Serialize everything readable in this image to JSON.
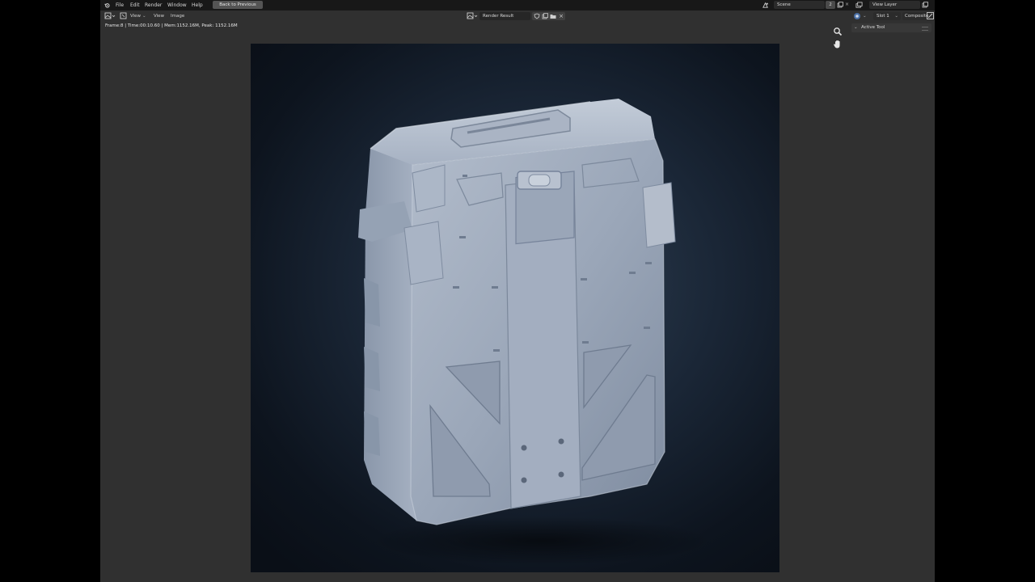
{
  "topbar": {
    "menus": [
      "File",
      "Edit",
      "Render",
      "Window",
      "Help"
    ],
    "back_button": "Back to Previous",
    "scene_name": "Scene",
    "scene_users": "2",
    "view_layer": "View Layer"
  },
  "image_editor": {
    "menus": [
      "View",
      "View",
      "Image"
    ],
    "image_name": "Render Result",
    "status": "Frame:8 | Time:00:10.60 | Mem:1152.16M, Peak: 1152.16M"
  },
  "sidebar": {
    "slot": "Slot 1",
    "layer_pass": "Composite",
    "panel_title": "Active Tool"
  },
  "icons": {
    "logo": "blender-logo-icon",
    "zoom": "zoom-icon",
    "pan": "hand-pan-icon",
    "editor_type": "image-editor-icon"
  },
  "colors": {
    "background": "#303030",
    "header": "#181818",
    "model": "#9aa6b9",
    "render_bg": "#111a26"
  }
}
